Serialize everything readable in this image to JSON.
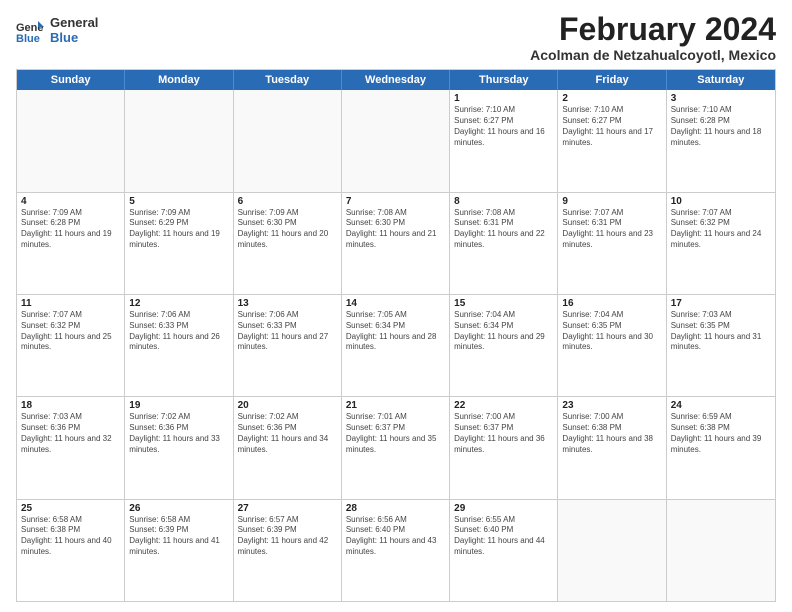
{
  "app": {
    "logo_general": "General",
    "logo_blue": "Blue"
  },
  "header": {
    "month": "February 2024",
    "location": "Acolman de Netzahualcoyotl, Mexico"
  },
  "days_of_week": [
    "Sunday",
    "Monday",
    "Tuesday",
    "Wednesday",
    "Thursday",
    "Friday",
    "Saturday"
  ],
  "rows": [
    [
      {
        "day": "",
        "info": ""
      },
      {
        "day": "",
        "info": ""
      },
      {
        "day": "",
        "info": ""
      },
      {
        "day": "",
        "info": ""
      },
      {
        "day": "1",
        "info": "Sunrise: 7:10 AM\nSunset: 6:27 PM\nDaylight: 11 hours and 16 minutes."
      },
      {
        "day": "2",
        "info": "Sunrise: 7:10 AM\nSunset: 6:27 PM\nDaylight: 11 hours and 17 minutes."
      },
      {
        "day": "3",
        "info": "Sunrise: 7:10 AM\nSunset: 6:28 PM\nDaylight: 11 hours and 18 minutes."
      }
    ],
    [
      {
        "day": "4",
        "info": "Sunrise: 7:09 AM\nSunset: 6:28 PM\nDaylight: 11 hours and 19 minutes."
      },
      {
        "day": "5",
        "info": "Sunrise: 7:09 AM\nSunset: 6:29 PM\nDaylight: 11 hours and 19 minutes."
      },
      {
        "day": "6",
        "info": "Sunrise: 7:09 AM\nSunset: 6:30 PM\nDaylight: 11 hours and 20 minutes."
      },
      {
        "day": "7",
        "info": "Sunrise: 7:08 AM\nSunset: 6:30 PM\nDaylight: 11 hours and 21 minutes."
      },
      {
        "day": "8",
        "info": "Sunrise: 7:08 AM\nSunset: 6:31 PM\nDaylight: 11 hours and 22 minutes."
      },
      {
        "day": "9",
        "info": "Sunrise: 7:07 AM\nSunset: 6:31 PM\nDaylight: 11 hours and 23 minutes."
      },
      {
        "day": "10",
        "info": "Sunrise: 7:07 AM\nSunset: 6:32 PM\nDaylight: 11 hours and 24 minutes."
      }
    ],
    [
      {
        "day": "11",
        "info": "Sunrise: 7:07 AM\nSunset: 6:32 PM\nDaylight: 11 hours and 25 minutes."
      },
      {
        "day": "12",
        "info": "Sunrise: 7:06 AM\nSunset: 6:33 PM\nDaylight: 11 hours and 26 minutes."
      },
      {
        "day": "13",
        "info": "Sunrise: 7:06 AM\nSunset: 6:33 PM\nDaylight: 11 hours and 27 minutes."
      },
      {
        "day": "14",
        "info": "Sunrise: 7:05 AM\nSunset: 6:34 PM\nDaylight: 11 hours and 28 minutes."
      },
      {
        "day": "15",
        "info": "Sunrise: 7:04 AM\nSunset: 6:34 PM\nDaylight: 11 hours and 29 minutes."
      },
      {
        "day": "16",
        "info": "Sunrise: 7:04 AM\nSunset: 6:35 PM\nDaylight: 11 hours and 30 minutes."
      },
      {
        "day": "17",
        "info": "Sunrise: 7:03 AM\nSunset: 6:35 PM\nDaylight: 11 hours and 31 minutes."
      }
    ],
    [
      {
        "day": "18",
        "info": "Sunrise: 7:03 AM\nSunset: 6:36 PM\nDaylight: 11 hours and 32 minutes."
      },
      {
        "day": "19",
        "info": "Sunrise: 7:02 AM\nSunset: 6:36 PM\nDaylight: 11 hours and 33 minutes."
      },
      {
        "day": "20",
        "info": "Sunrise: 7:02 AM\nSunset: 6:36 PM\nDaylight: 11 hours and 34 minutes."
      },
      {
        "day": "21",
        "info": "Sunrise: 7:01 AM\nSunset: 6:37 PM\nDaylight: 11 hours and 35 minutes."
      },
      {
        "day": "22",
        "info": "Sunrise: 7:00 AM\nSunset: 6:37 PM\nDaylight: 11 hours and 36 minutes."
      },
      {
        "day": "23",
        "info": "Sunrise: 7:00 AM\nSunset: 6:38 PM\nDaylight: 11 hours and 38 minutes."
      },
      {
        "day": "24",
        "info": "Sunrise: 6:59 AM\nSunset: 6:38 PM\nDaylight: 11 hours and 39 minutes."
      }
    ],
    [
      {
        "day": "25",
        "info": "Sunrise: 6:58 AM\nSunset: 6:38 PM\nDaylight: 11 hours and 40 minutes."
      },
      {
        "day": "26",
        "info": "Sunrise: 6:58 AM\nSunset: 6:39 PM\nDaylight: 11 hours and 41 minutes."
      },
      {
        "day": "27",
        "info": "Sunrise: 6:57 AM\nSunset: 6:39 PM\nDaylight: 11 hours and 42 minutes."
      },
      {
        "day": "28",
        "info": "Sunrise: 6:56 AM\nSunset: 6:40 PM\nDaylight: 11 hours and 43 minutes."
      },
      {
        "day": "29",
        "info": "Sunrise: 6:55 AM\nSunset: 6:40 PM\nDaylight: 11 hours and 44 minutes."
      },
      {
        "day": "",
        "info": ""
      },
      {
        "day": "",
        "info": ""
      }
    ]
  ]
}
